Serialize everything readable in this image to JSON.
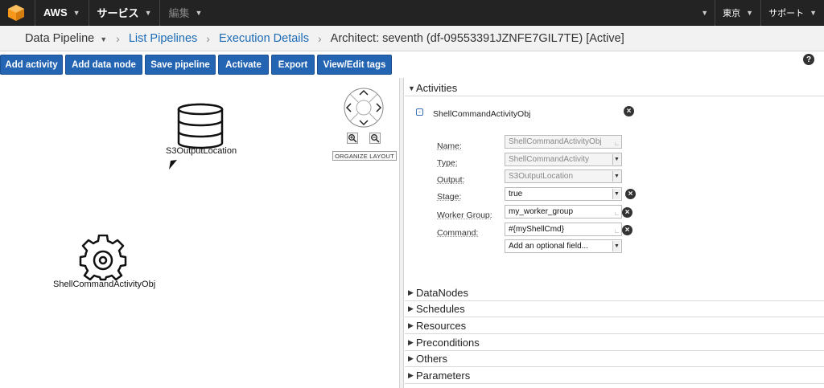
{
  "topnav": {
    "brand": "AWS",
    "services": "サービス",
    "edit": "編集",
    "region": "東京",
    "support": "サポート"
  },
  "breadcrumb": {
    "root": "Data Pipeline",
    "list": "List Pipelines",
    "details": "Execution Details",
    "current": "Architect: seventh (df-09553391JZNFE7GIL7TE) [Active]"
  },
  "toolbar": {
    "add_activity": "Add activity",
    "add_data_node": "Add data node",
    "save_pipeline": "Save pipeline",
    "activate": "Activate",
    "export": "Export",
    "view_edit_tags": "View/Edit tags"
  },
  "canvas": {
    "data_node_label": "S3OutputLocation",
    "activity_node_label": "ShellCommandActivityObj",
    "organize_layout": "ORGANIZE LAYOUT"
  },
  "panel": {
    "activities_header": "Activities",
    "object_title": "ShellCommandActivityObj",
    "fields": {
      "name_label": "Name:",
      "name_value": "ShellCommandActivityObj",
      "type_label": "Type:",
      "type_value": "ShellCommandActivity",
      "output_label": "Output:",
      "output_value": "S3OutputLocation",
      "stage_label": "Stage:",
      "stage_value": "true",
      "worker_group_label": "Worker Group:",
      "worker_group_value": "my_worker_group",
      "command_label": "Command:",
      "command_value": "#{myShellCmd}",
      "optional_field": "Add an optional field..."
    },
    "sections": {
      "datanodes": "DataNodes",
      "schedules": "Schedules",
      "resources": "Resources",
      "preconditions": "Preconditions",
      "others": "Others",
      "parameters": "Parameters"
    }
  }
}
